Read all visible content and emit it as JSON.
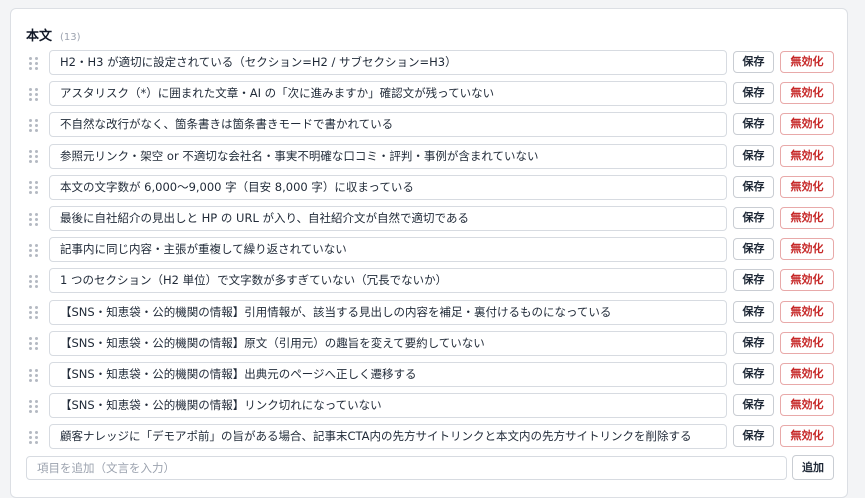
{
  "section": {
    "title": "本文",
    "count": "(13)"
  },
  "labels": {
    "save": "保存",
    "disable": "無効化",
    "add": "追加"
  },
  "add_input": {
    "placeholder": "項目を追加（文言を入力）",
    "value": ""
  },
  "items": [
    "H2・H3 が適切に設定されている（セクション=H2 / サブセクション=H3）",
    "アスタリスク（*）に囲まれた文章・AI の「次に進みますか」確認文が残っていない",
    "不自然な改行がなく、箇条書きは箇条書きモードで書かれている",
    "参照元リンク・架空 or 不適切な会社名・事実不明確な口コミ・評判・事例が含まれていない",
    "本文の文字数が 6,000〜9,000 字（目安 8,000 字）に収まっている",
    "最後に自社紹介の見出しと HP の URL が入り、自社紹介文が自然で適切である",
    "記事内に同じ内容・主張が重複して繰り返されていない",
    "1 つのセクション（H2 単位）で文字数が多すぎていない（冗長でないか）",
    "【SNS・知恵袋・公的機関の情報】引用情報が、該当する見出しの内容を補足・裏付けるものになっている",
    "【SNS・知恵袋・公的機関の情報】原文（引用元）の趣旨を変えて要約していない",
    "【SNS・知恵袋・公的機関の情報】出典元のページへ正しく遷移する",
    "【SNS・知恵袋・公的機関の情報】リンク切れになっていない",
    "顧客ナレッジに「デモアポ前」の旨がある場合、記事末CTA内の先方サイトリンクと本文内の先方サイトリンクを削除する"
  ],
  "colors": {
    "disable_text": "#c62828",
    "disable_border": "#e8a9a9"
  }
}
